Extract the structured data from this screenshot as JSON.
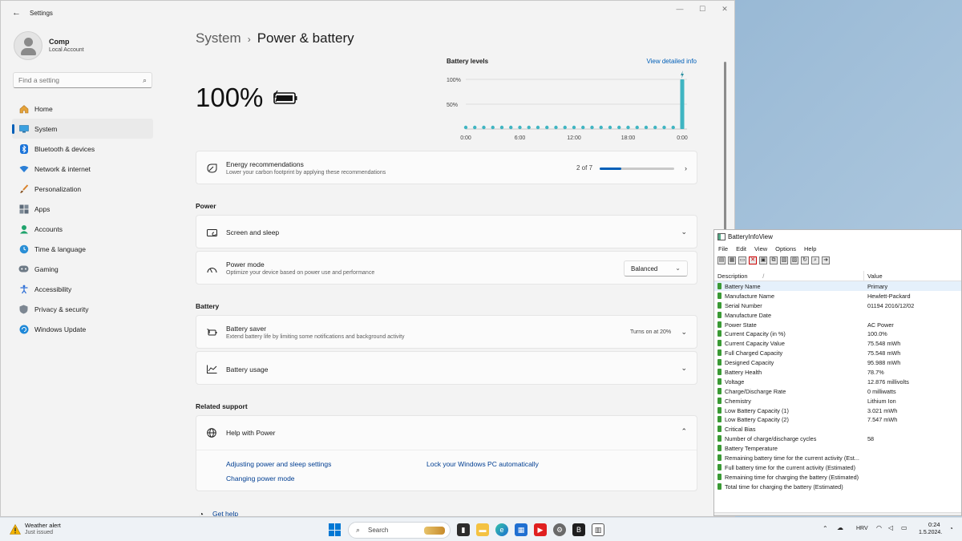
{
  "window": {
    "title": "Settings",
    "back_icon": "back-arrow-icon",
    "minimize": "—",
    "maximize": "☐",
    "close": "✕"
  },
  "profile": {
    "name": "Comp",
    "account": "Local Account"
  },
  "search": {
    "placeholder": "Find a setting"
  },
  "sidebar": {
    "items": [
      {
        "label": "Home",
        "icon": "home-icon"
      },
      {
        "label": "System",
        "icon": "system-icon",
        "active": true
      },
      {
        "label": "Bluetooth & devices",
        "icon": "bluetooth-icon"
      },
      {
        "label": "Network & internet",
        "icon": "wifi-icon"
      },
      {
        "label": "Personalization",
        "icon": "brush-icon"
      },
      {
        "label": "Apps",
        "icon": "apps-icon"
      },
      {
        "label": "Accounts",
        "icon": "accounts-icon"
      },
      {
        "label": "Time & language",
        "icon": "globe-clock-icon"
      },
      {
        "label": "Gaming",
        "icon": "gamepad-icon"
      },
      {
        "label": "Accessibility",
        "icon": "accessibility-icon"
      },
      {
        "label": "Privacy & security",
        "icon": "shield-icon"
      },
      {
        "label": "Windows Update",
        "icon": "update-icon"
      }
    ]
  },
  "breadcrumb": {
    "parent": "System",
    "separator": "›",
    "current": "Power & battery"
  },
  "battery": {
    "percent": "100%",
    "charging": true
  },
  "chart_data": {
    "type": "bar",
    "title": "Battery levels",
    "link": "View detailed info",
    "y_ticks": [
      "100%",
      "50%"
    ],
    "x_ticks": [
      "0:00",
      "6:00",
      "12:00",
      "18:00",
      "0:00"
    ],
    "ylim": [
      0,
      100
    ],
    "points": 25,
    "values": [
      0,
      0,
      0,
      0,
      0,
      0,
      0,
      0,
      0,
      0,
      0,
      0,
      0,
      0,
      0,
      0,
      0,
      0,
      0,
      0,
      0,
      0,
      0,
      0,
      100
    ],
    "accent": "#3fb5c2"
  },
  "energy": {
    "title": "Energy recommendations",
    "subtitle": "Lower your carbon footprint by applying these recommendations",
    "progress_text": "2 of 7",
    "progress": 0.2857
  },
  "power_section": {
    "heading": "Power",
    "screen_sleep": "Screen and sleep",
    "power_mode_title": "Power mode",
    "power_mode_sub": "Optimize your device based on power use and performance",
    "power_mode_value": "Balanced"
  },
  "battery_section": {
    "heading": "Battery",
    "saver_title": "Battery saver",
    "saver_sub": "Extend battery life by limiting some notifications and background activity",
    "saver_status": "Turns on at 20%",
    "usage_title": "Battery usage"
  },
  "support": {
    "heading": "Related support",
    "help_title": "Help with Power",
    "links": [
      "Adjusting power and sleep settings",
      "Lock your Windows PC automatically",
      "Changing power mode"
    ],
    "get_help": "Get help"
  },
  "biv": {
    "title": "BatteryInfoView",
    "menu": [
      "File",
      "Edit",
      "View",
      "Options",
      "Help"
    ],
    "col_desc": "Description",
    "col_sort": "/",
    "col_val": "Value",
    "rows": [
      {
        "d": "Battery Name",
        "v": "Primary"
      },
      {
        "d": "Manufacture Name",
        "v": "Hewlett-Packard"
      },
      {
        "d": "Serial Number",
        "v": "01194 2016/12/02"
      },
      {
        "d": "Manufacture Date",
        "v": ""
      },
      {
        "d": "Power State",
        "v": "AC Power"
      },
      {
        "d": "Current Capacity (in %)",
        "v": "100.0%"
      },
      {
        "d": "Current Capacity Value",
        "v": "75.548 mWh"
      },
      {
        "d": "Full Charged Capacity",
        "v": "75.548 mWh"
      },
      {
        "d": "Designed Capacity",
        "v": "95.988 mWh"
      },
      {
        "d": "Battery Health",
        "v": "78.7%"
      },
      {
        "d": "Voltage",
        "v": "12.876 millivolts"
      },
      {
        "d": "Charge/Discharge Rate",
        "v": "0 milliwatts"
      },
      {
        "d": "Chemistry",
        "v": "Lithium Ion"
      },
      {
        "d": "Low Battery Capacity (1)",
        "v": "3.021 mWh"
      },
      {
        "d": "Low Battery Capacity (2)",
        "v": "7.547 mWh"
      },
      {
        "d": "Critical Bias",
        "v": ""
      },
      {
        "d": "Number of charge/discharge cycles",
        "v": "58"
      },
      {
        "d": "Battery Temperature",
        "v": ""
      },
      {
        "d": "Remaining battery time for the current activity (Est...",
        "v": ""
      },
      {
        "d": "Full battery time for the current activity (Estimated)",
        "v": ""
      },
      {
        "d": "Remaining time for charging the battery (Estimated)",
        "v": ""
      },
      {
        "d": "Total  time for charging the battery (Estimated)",
        "v": ""
      }
    ]
  },
  "taskbar": {
    "weather_title": "Weather alert",
    "weather_sub": "Just issued",
    "search_label": "Search",
    "lang": "HRV",
    "time": "0:24",
    "date": "1.5.2024."
  }
}
